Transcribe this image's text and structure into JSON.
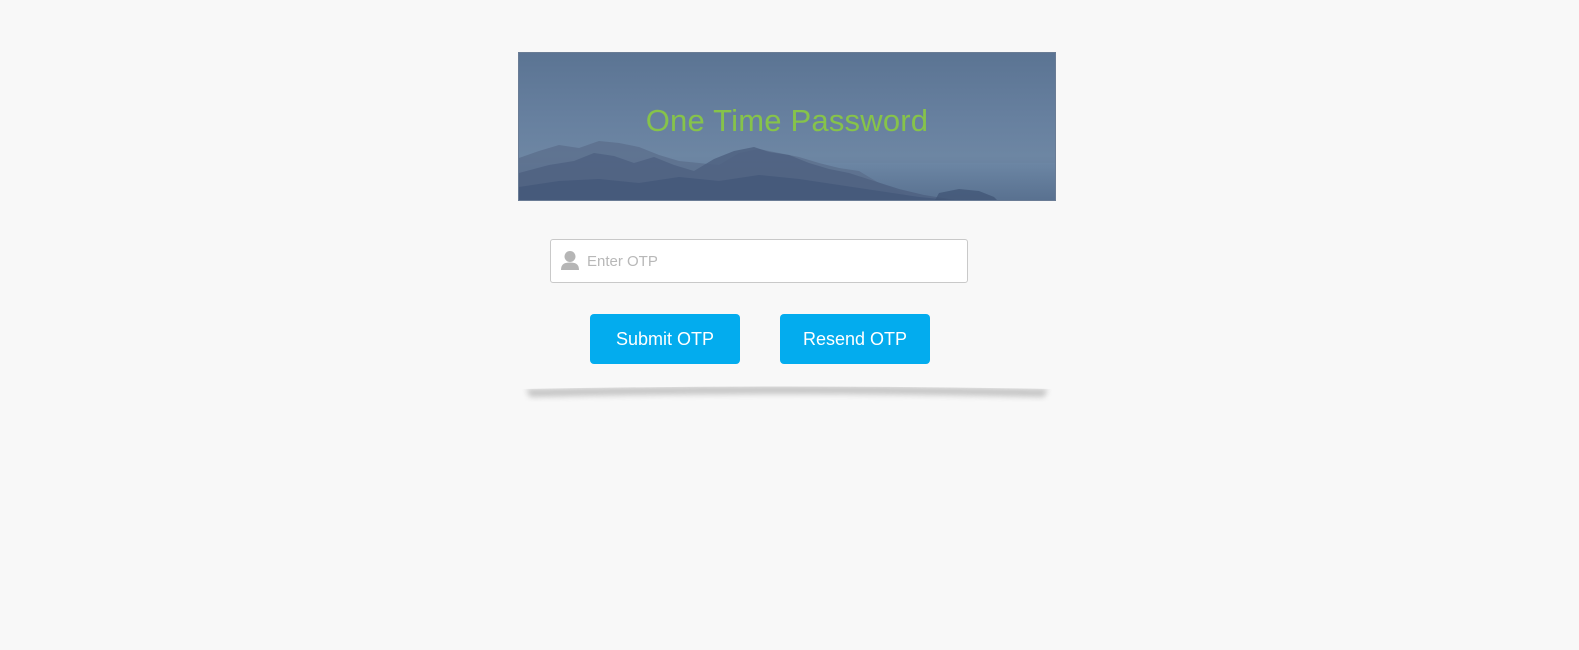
{
  "banner": {
    "title": "One Time Password"
  },
  "otp_input": {
    "placeholder": "Enter OTP",
    "value": "",
    "icon": "user-icon"
  },
  "buttons": {
    "submit_label": "Submit OTP",
    "resend_label": "Resend OTP"
  },
  "colors": {
    "title": "#86c34a",
    "button": "#03acee",
    "page_background": "#f8f8f8"
  }
}
